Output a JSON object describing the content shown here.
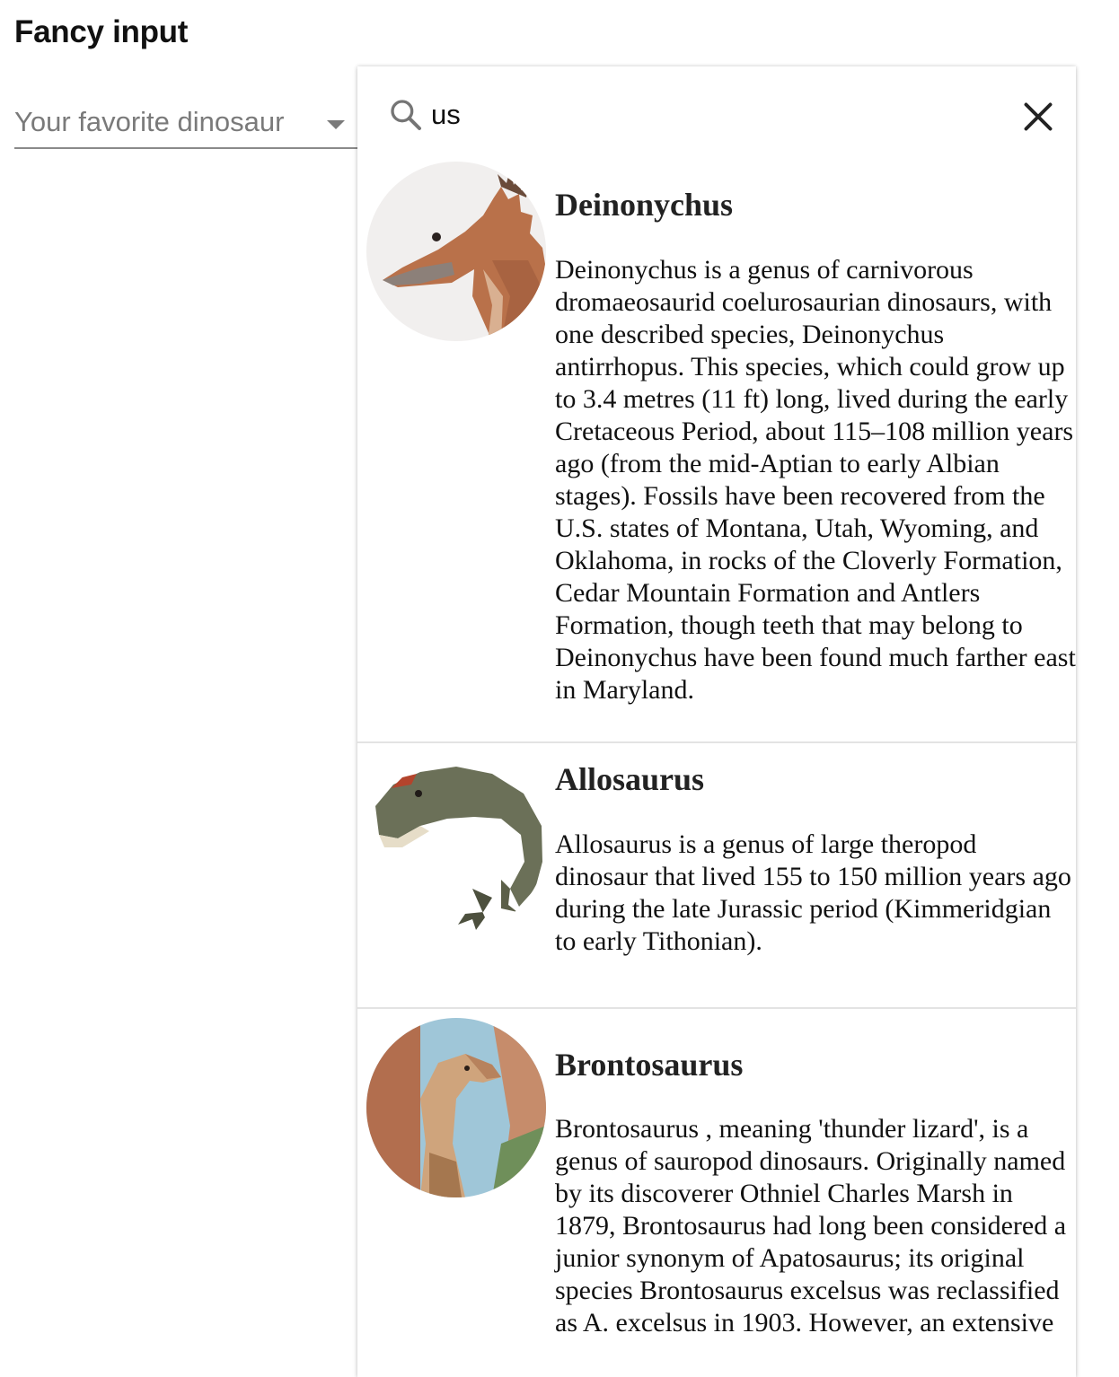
{
  "page": {
    "title": "Fancy input"
  },
  "select": {
    "placeholder": "Your favorite dinosaur"
  },
  "search": {
    "value": "us"
  },
  "results": [
    {
      "name": "Deinonychus",
      "description": "Deinonychus is a genus of carnivorous dromaeosaurid coelurosaurian dinosaurs, with one described species, Deinonychus antirrhopus. This species, which could grow up to 3.4 metres (11 ft) long, lived during the early Cretaceous Period, about 115–108 million years ago (from the mid-Aptian to early Albian stages). Fossils have been recovered from the U.S. states of Montana, Utah, Wyoming, and Oklahoma, in rocks of the Cloverly Formation, Cedar Mountain Formation and Antlers Formation, though teeth that may belong to Deinonychus have been found much farther east in Maryland."
    },
    {
      "name": "Allosaurus",
      "description": "Allosaurus is a genus of large theropod dinosaur that lived 155 to 150 million years ago during the late Jurassic period (Kimmeridgian to early Tithonian)."
    },
    {
      "name": "Brontosaurus",
      "description": "Brontosaurus , meaning 'thunder lizard', is a genus of sauropod dinosaurs. Originally named by its discoverer Othniel Charles Marsh in 1879, Brontosaurus had long been considered a junior synonym of Apatosaurus; its original species Brontosaurus excelsus was reclassified as A. excelsus in 1903. However, an extensive"
    }
  ]
}
